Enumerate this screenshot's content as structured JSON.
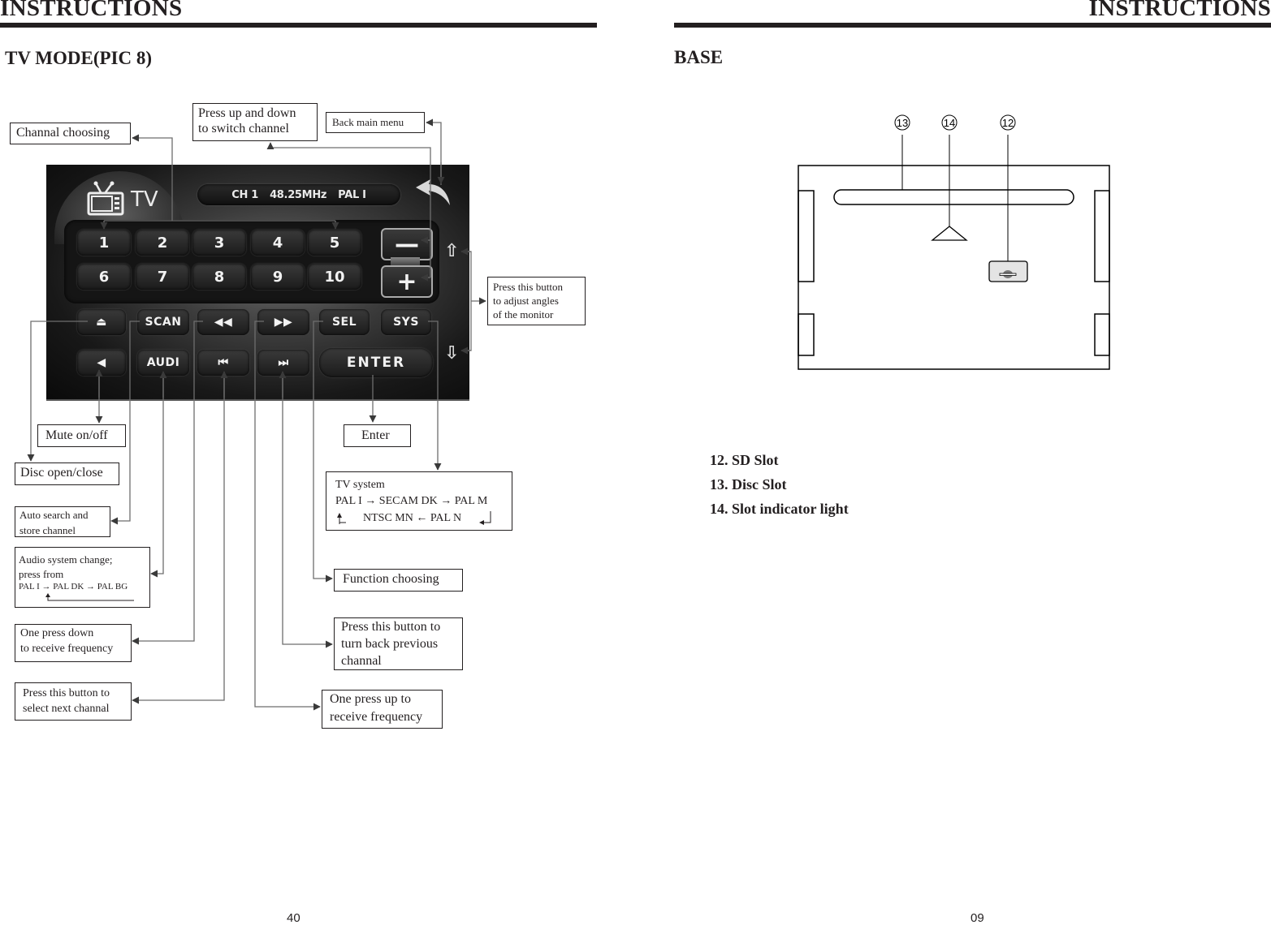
{
  "left_page": {
    "header": "INSTRUCTIONS",
    "title": "TV MODE(PIC 8)",
    "page_number": "40",
    "panel": {
      "status_channel": "CH 1",
      "status_frequency": "48.25MHz",
      "status_system": "PAL I",
      "mode_label": "TV",
      "number_keys": [
        "1",
        "2",
        "3",
        "4",
        "5",
        "6",
        "7",
        "8",
        "9",
        "10"
      ],
      "minus_label": "—",
      "plus_label": "+",
      "row3_keys": [
        "⏏",
        "SCAN",
        "◀◀",
        "▶▶",
        "SEL",
        "SYS"
      ],
      "row4_keys": [
        "◀",
        "AUDI",
        "⏮",
        "⏭"
      ],
      "enter_label": "ENTER",
      "angle_up": "⇧",
      "angle_down": "⇩"
    },
    "callouts": {
      "channel_choosing": "Channal choosing",
      "switch_channel": [
        "Press up and down",
        "to switch channel"
      ],
      "back_main_menu": "Back main menu",
      "adjust_angles": [
        "Press this button",
        "to adjust angles",
        "of the monitor"
      ],
      "mute": "Mute on/off",
      "enter": "Enter",
      "disc_open": "Disc open/close",
      "tv_system_title": "TV system",
      "tv_system_row1": "PAL I  → SECAM DK → PAL M",
      "tv_system_row2": "NTSC MN  ← PAL N",
      "auto_search": [
        "Auto search and",
        "store channel"
      ],
      "audio_system": [
        "Audio system change;",
        "press from"
      ],
      "audio_system_cycle": "PAL I → PAL DK → PAL BG",
      "function_choosing": "Function choosing",
      "previous_channel": [
        "Press this button to",
        "turn back previous",
        "channal"
      ],
      "press_down_frequency": [
        "One press down",
        "to receive frequency"
      ],
      "next_channel": [
        "Press this button to",
        "select next channal"
      ],
      "press_up_frequency": [
        "One press up to",
        "receive frequency"
      ]
    }
  },
  "right_page": {
    "header": "INSTRUCTIONS",
    "title": "BASE",
    "page_number": "09",
    "diagram_markers": [
      "13",
      "14",
      "12"
    ],
    "legend": [
      "12. SD Slot",
      "13. Disc Slot",
      "14. Slot indicator light"
    ]
  }
}
